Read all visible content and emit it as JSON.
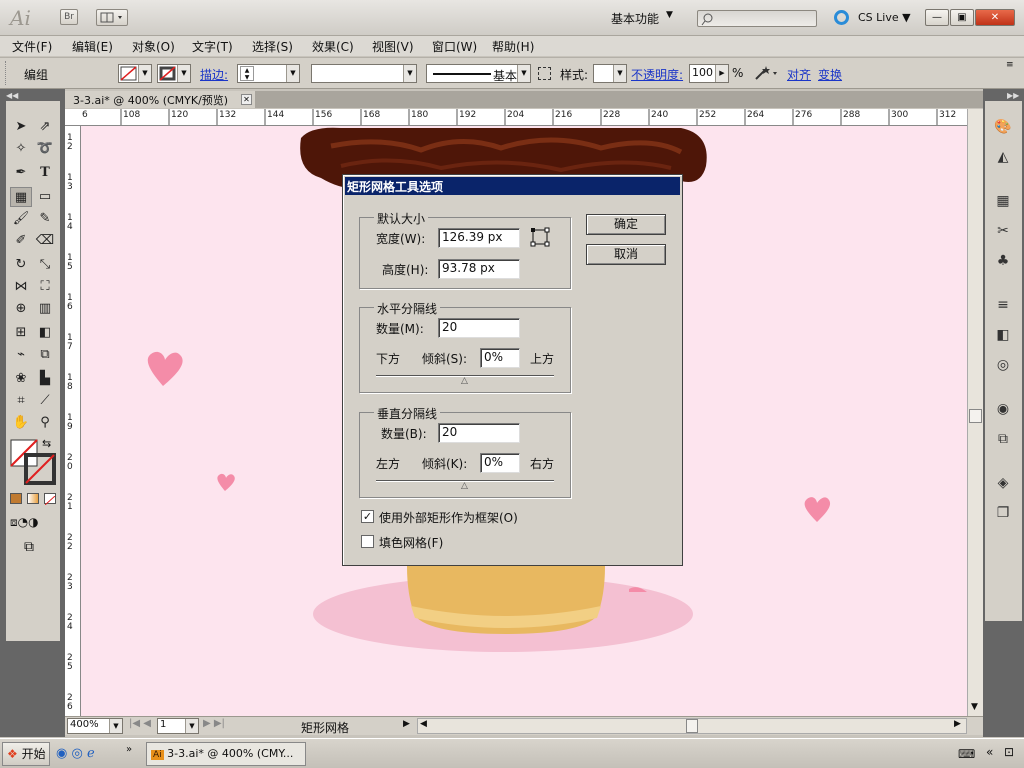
{
  "app": {
    "logo": "Ai",
    "bridge": "Br",
    "workspace": "基本功能",
    "cs_live": "CS Live"
  },
  "menu": [
    "文件(F)",
    "编辑(E)",
    "对象(O)",
    "文字(T)",
    "选择(S)",
    "效果(C)",
    "视图(V)",
    "窗口(W)",
    "帮助(H)"
  ],
  "control": {
    "mode": "编组",
    "stroke_link": "描边:",
    "stroke_style": "基本",
    "style_label": "样式:",
    "opacity_link": "不透明度:",
    "opacity_value": "100",
    "opacity_unit": "%",
    "align_link": "对齐",
    "transform_link": "变换"
  },
  "document": {
    "tab_title": "3-3.ai* @ 400% (CMYK/预览)",
    "zoom": "400%",
    "artboard": "1",
    "status": "矩形网格"
  },
  "ruler": {
    "top": [
      "6",
      "108",
      "120",
      "132",
      "144",
      "156",
      "168",
      "180",
      "192",
      "204",
      "216",
      "228",
      "240",
      "252",
      "264",
      "276",
      "288",
      "300",
      "312"
    ],
    "left": [
      "1 2",
      "1 3",
      "1 4",
      "1 5",
      "1 6",
      "1 7",
      "1 8",
      "1 9",
      "2 0",
      "2 1",
      "2 2",
      "2 3",
      "2 4",
      "2 5",
      "2 6"
    ]
  },
  "dialog": {
    "title": "矩形网格工具选项",
    "default_size": {
      "group": "默认大小",
      "width_label": "宽度(W):",
      "width_value": "126.39 px",
      "height_label": "高度(H):",
      "height_value": "93.78 px"
    },
    "horizontal": {
      "group": "水平分隔线",
      "count_label": "数量(M):",
      "count_value": "20",
      "left": "下方",
      "skew_label": "倾斜(S):",
      "skew_value": "0%",
      "right": "上方"
    },
    "vertical": {
      "group": "垂直分隔线",
      "count_label": "数量(B):",
      "count_value": "20",
      "left": "左方",
      "skew_label": "倾斜(K):",
      "skew_value": "0%",
      "right": "右方"
    },
    "use_outer_rect": "使用外部矩形作为框架(O)",
    "use_outer_rect_checked": true,
    "fill_grid": "填色网格(F)",
    "fill_grid_checked": false,
    "ok": "确定",
    "cancel": "取消"
  },
  "taskbar": {
    "start": "开始",
    "task_label": "3-3.ai* @ 400% (CMY...",
    "task_icon": "Ai"
  },
  "colors": {
    "canvas": "#fde4ee",
    "chocolate": "#5a1a0a",
    "cone": "#e8b860",
    "heart": "#f48ca8",
    "dialog_title": "#0a246a"
  }
}
